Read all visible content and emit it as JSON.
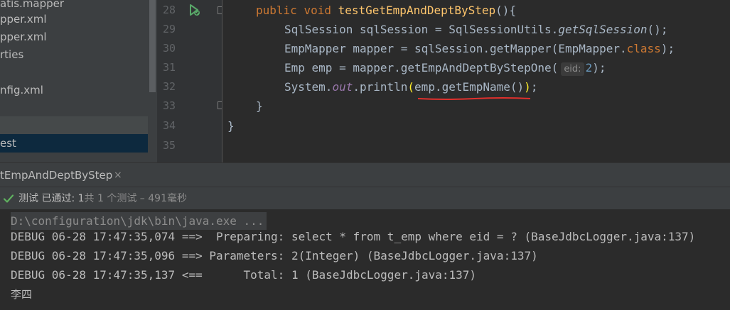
{
  "project_tree": {
    "items": [
      {
        "label": "atis.mapper"
      },
      {
        "label": "pper.xml"
      },
      {
        "label": "pper.xml"
      },
      {
        "label": "rties"
      },
      {
        "label": "nfig.xml"
      },
      {
        "label": "est"
      }
    ]
  },
  "editor": {
    "line_numbers": [
      "28",
      "29",
      "30",
      "31",
      "32",
      "33",
      "34",
      "35"
    ],
    "line28": {
      "kw1": "public",
      "kw2": "void",
      "method": "testGetEmpAndDeptByStep",
      "rest": "(){"
    },
    "line29": {
      "decl": "SqlSession sqlSession = SqlSessionUtils.",
      "call": "getSqlSession",
      "rest": "();"
    },
    "line30": {
      "decl": "EmpMapper mapper = sqlSession.getMapper(EmpMapper.",
      "kw": "class",
      "rest": ");"
    },
    "line31": {
      "decl": "Emp emp = mapper.getEmpAndDeptByStepOne(",
      "hint": "eid:",
      "arg": "2",
      "rest": ");"
    },
    "line32": {
      "pre": "System.",
      "field": "out",
      "mid": ".println",
      "open": "(",
      "arg": "emp.getEmpName()",
      "close": ")",
      "rest": ";"
    },
    "line33": {
      "text": "}"
    },
    "line34": {
      "text": "}"
    },
    "underline_color": "#e0302d"
  },
  "run_window": {
    "tab_label": "tEmpAndDeptByStep",
    "tab_close": "×",
    "status": {
      "prefix": "测试 已通过: ",
      "passed": "1",
      "detail": "共 1 个测试 – 491毫秒"
    },
    "console": [
      "D:\\configuration\\jdk\\bin\\java.exe ...",
      "DEBUG 06-28 17:47:35,074 ==>  Preparing: select * from t_emp where eid = ? (BaseJdbcLogger.java:137)",
      "DEBUG 06-28 17:47:35,096 ==> Parameters: 2(Integer) (BaseJdbcLogger.java:137)",
      "DEBUG 06-28 17:47:35,137 <==      Total: 1 (BaseJdbcLogger.java:137)",
      "李四"
    ]
  },
  "colors": {
    "keyword": "#cc7832",
    "method": "#ffc66d",
    "number": "#6897bb",
    "static_field": "#9876aa",
    "pass_green": "#5fb15f"
  },
  "icons": [
    "run-gutter-icon",
    "fold-marker-icon",
    "check-icon",
    "close-icon"
  ]
}
